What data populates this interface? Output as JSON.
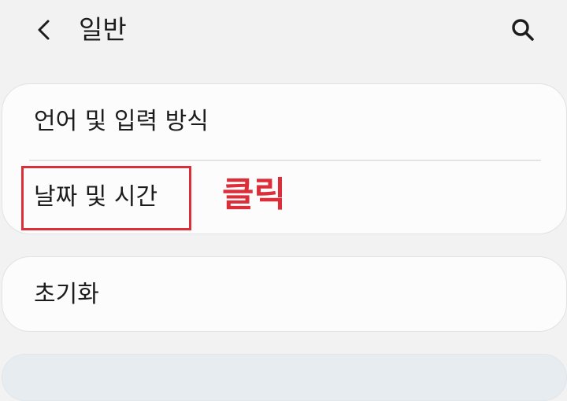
{
  "header": {
    "title": "일반",
    "back_icon": "chevron-left-icon",
    "search_icon": "search-icon"
  },
  "settings": {
    "group_1": [
      {
        "label": "언어 및 입력 방식"
      },
      {
        "label": "날짜 및 시간"
      }
    ],
    "group_2": [
      {
        "label": "초기화"
      }
    ]
  },
  "annotation": {
    "text": "클릭",
    "color": "#dc2e39"
  }
}
